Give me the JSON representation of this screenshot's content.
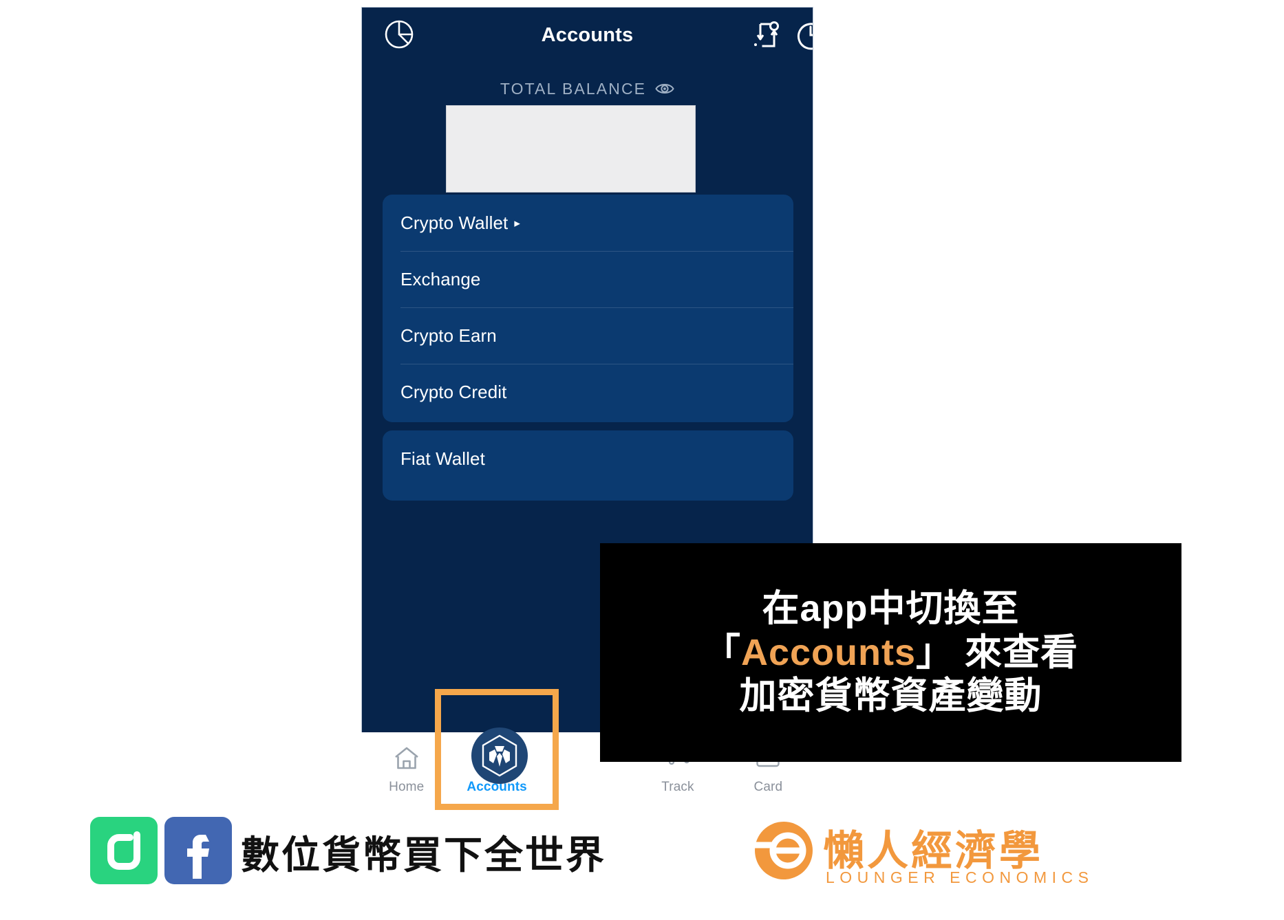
{
  "app": {
    "screen_title": "Accounts",
    "header_icons": {
      "left": "pie-chart-icon",
      "right_1": "transfer-icon",
      "right_2": "clock-dollar-icon"
    },
    "balance": {
      "label": "TOTAL BALANCE",
      "eye_icon": "eye-icon",
      "value_redacted": true
    },
    "account_groups": [
      {
        "items": [
          {
            "label": "Crypto Wallet",
            "caret": "▸",
            "has_caret": true
          },
          {
            "label": "Exchange",
            "caret": "",
            "has_caret": false
          },
          {
            "label": "Crypto Earn",
            "caret": "",
            "has_caret": false
          },
          {
            "label": "Crypto Credit",
            "caret": "",
            "has_caret": false
          }
        ]
      },
      {
        "items": [
          {
            "label": "Fiat Wallet",
            "caret": "",
            "has_caret": false
          }
        ]
      }
    ],
    "bottom_nav": [
      {
        "label": "Home",
        "icon": "home-icon",
        "active": false
      },
      {
        "label": "Accounts",
        "icon": "wallet-icon",
        "active": true
      },
      {
        "label": "",
        "icon": "cro-logo-icon",
        "active": false
      },
      {
        "label": "Track",
        "icon": "track-icon",
        "active": false
      },
      {
        "label": "Card",
        "icon": "card-icon",
        "active": false
      }
    ]
  },
  "annotation": {
    "highlight_target": "Accounts",
    "highlight_color": "#f5a council",
    "caption_lines": [
      {
        "prefix": "在app中切換至",
        "accent": "",
        "suffix": ""
      },
      {
        "prefix": "「",
        "accent": "Accounts",
        "suffix": "」 來查看"
      },
      {
        "prefix": "加密貨幣資產變動",
        "accent": "",
        "suffix": ""
      }
    ]
  },
  "footer": {
    "social": [
      {
        "name": "line-icon",
        "color": "#29d37f"
      },
      {
        "name": "facebook-icon",
        "color": "#4267b2"
      }
    ],
    "slogan": "數位貨幣買下全世界",
    "brand_cn": "懶人經濟學",
    "brand_en": "LOUNGER ECONOMICS",
    "brand_color": "#f2983d"
  },
  "colors": {
    "phone_bg": "#06244b",
    "card_bg": "#0b3a70",
    "accent_blue": "#1199fa",
    "highlight_orange": "#f5a council",
    "mask_grey": "#ededee"
  }
}
